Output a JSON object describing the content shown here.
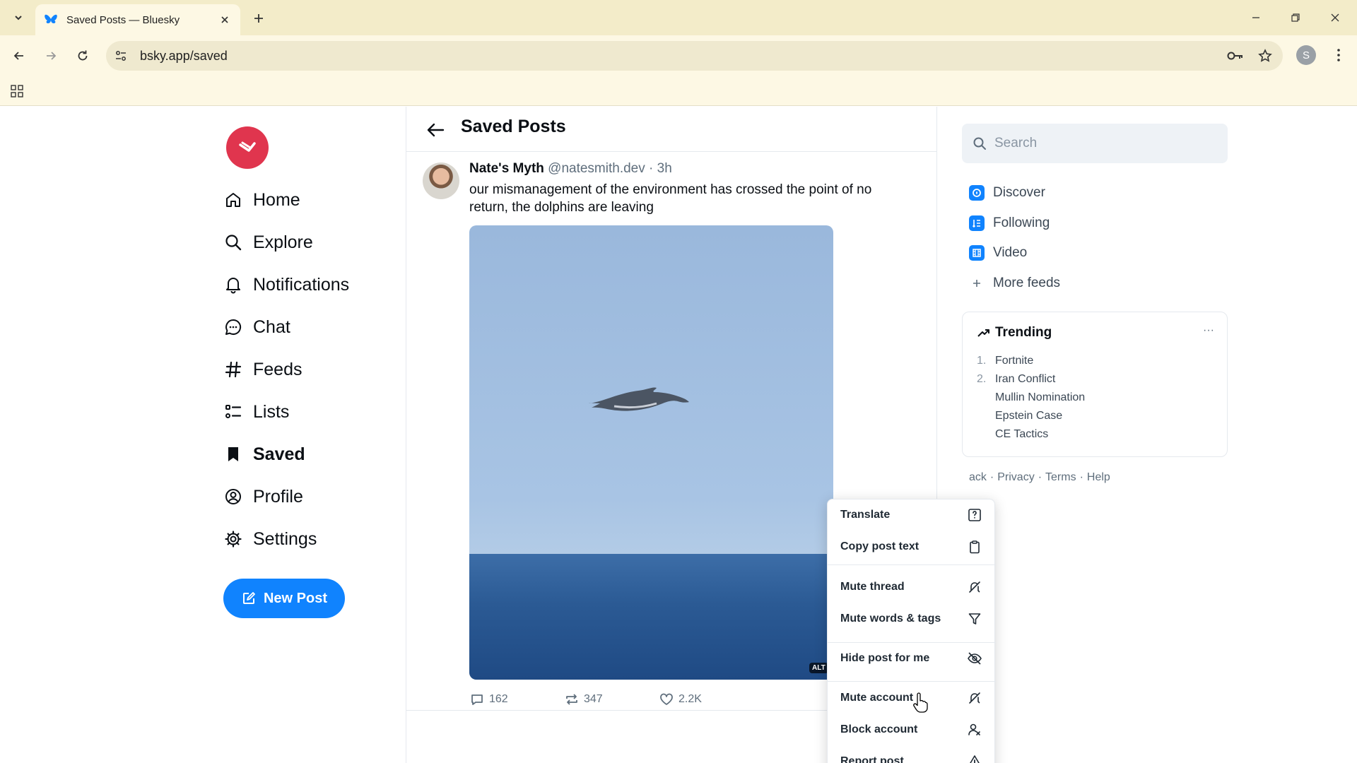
{
  "browser": {
    "tab_title": "Saved Posts — Bluesky",
    "url": "bsky.app/saved",
    "profile_initial": "S"
  },
  "leftnav": {
    "items": [
      {
        "label": "Home",
        "icon": "home-icon"
      },
      {
        "label": "Explore",
        "icon": "search-icon"
      },
      {
        "label": "Notifications",
        "icon": "bell-icon"
      },
      {
        "label": "Chat",
        "icon": "chat-icon"
      },
      {
        "label": "Feeds",
        "icon": "hashtag-icon"
      },
      {
        "label": "Lists",
        "icon": "list-icon"
      },
      {
        "label": "Saved",
        "icon": "bookmark-icon",
        "active": true
      },
      {
        "label": "Profile",
        "icon": "profile-icon"
      },
      {
        "label": "Settings",
        "icon": "gear-icon"
      }
    ],
    "new_post_label": "New Post"
  },
  "center": {
    "title": "Saved Posts",
    "post": {
      "author_name": "Nate's Myth",
      "author_handle": "@natesmith.dev",
      "time": "· 3h",
      "text": "our mismanagement of the environment has crossed the point of no return, the dolphins are leaving",
      "alt_badge": "ALT",
      "replies": "162",
      "reposts": "347",
      "likes": "2.2K"
    }
  },
  "right": {
    "search_placeholder": "Search",
    "feeds": [
      {
        "label": "Discover",
        "icon": "discover-icon"
      },
      {
        "label": "Following",
        "icon": "following-icon"
      },
      {
        "label": "Video",
        "icon": "video-icon"
      },
      {
        "label": "More feeds",
        "icon": "plus-icon"
      }
    ],
    "trending": {
      "title": "Trending",
      "items": [
        {
          "num": "1.",
          "label": "Fortnite"
        },
        {
          "num": "2.",
          "label": "Iran Conflict"
        },
        {
          "num": "",
          "label": "Mullin Nomination"
        },
        {
          "num": "",
          "label": "Epstein Case"
        },
        {
          "num": "",
          "label": "CE Tactics"
        }
      ]
    },
    "footer": [
      "ack",
      "Privacy",
      "Terms",
      "Help"
    ]
  },
  "context_menu": {
    "items": [
      {
        "label": "Translate",
        "icon": "translate-icon"
      },
      {
        "label": "Copy post text",
        "icon": "clipboard-icon"
      },
      {
        "label": "Mute thread",
        "icon": "mute-thread-icon"
      },
      {
        "label": "Mute words & tags",
        "icon": "filter-icon"
      },
      {
        "label": "Hide post for me",
        "icon": "eye-slash-icon"
      },
      {
        "label": "Mute account",
        "icon": "mute-account-icon"
      },
      {
        "label": "Block account",
        "icon": "block-user-icon"
      },
      {
        "label": "Report post",
        "icon": "warning-icon"
      }
    ]
  },
  "colors": {
    "accent": "#1083fe",
    "logo": "#e0354e",
    "chrome": "#fdf8e4"
  }
}
